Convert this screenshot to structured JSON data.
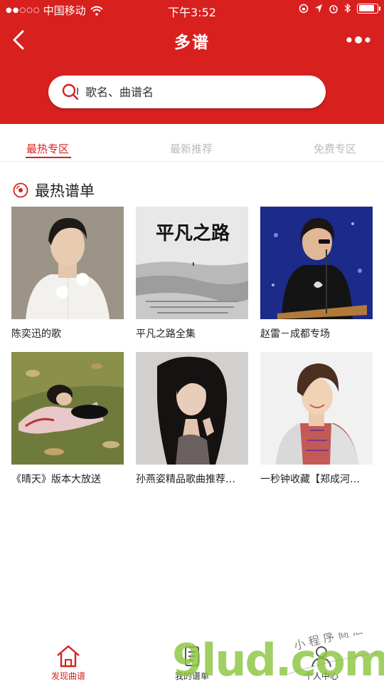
{
  "status_bar": {
    "signal_dots": "●●○○○",
    "carrier": "中国移动",
    "time": "下午3:52",
    "battery_level": 0.85
  },
  "nav": {
    "title": "多谱"
  },
  "search": {
    "placeholder": "歌名、曲谱名"
  },
  "tabs": [
    {
      "label": "最热专区",
      "active": true
    },
    {
      "label": "最新推荐",
      "active": false
    },
    {
      "label": "免费专区",
      "active": false
    }
  ],
  "section": {
    "title": "最热谱单"
  },
  "cards": [
    {
      "caption": "陈奕迅的歌"
    },
    {
      "caption": "平凡之路全集",
      "cover_text": "平凡之路"
    },
    {
      "caption": "赵雷－成都专场"
    },
    {
      "caption": "《晴天》版本大放送"
    },
    {
      "caption": "孙燕姿精品歌曲推荐…"
    },
    {
      "caption": "一秒钟收藏【郑成河…"
    }
  ],
  "bottom_nav": [
    {
      "label": "发现曲谱",
      "active": true
    },
    {
      "label": "我的谱单",
      "active": false
    },
    {
      "label": "个人中心",
      "active": false
    }
  ],
  "watermark": {
    "logo": "9lud.com",
    "tagline": "小程序商店"
  },
  "colors": {
    "brand_red": "#d8201f",
    "tab_inactive": "#bbbbbb",
    "watermark_green": "#8cc63f",
    "watermark_orange": "#f29b1f"
  }
}
